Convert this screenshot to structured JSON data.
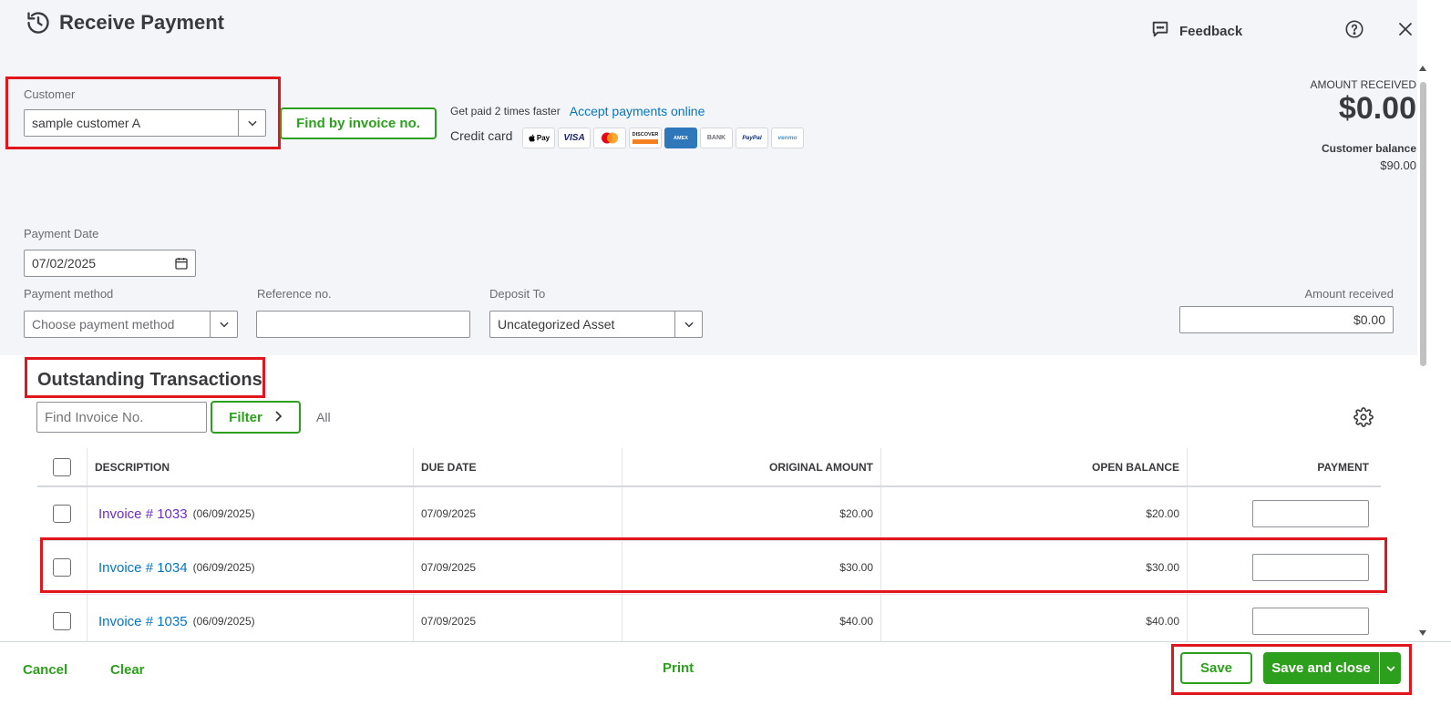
{
  "header": {
    "title": "Receive Payment",
    "feedback_label": "Feedback"
  },
  "customer": {
    "label": "Customer",
    "value": "sample customer A",
    "find_button": "Find by invoice no."
  },
  "online": {
    "promo_text": "Get paid 2 times faster",
    "accept_link": "Accept payments online",
    "credit_card_label": "Credit card",
    "cards": [
      "Pay",
      "VISA",
      "",
      "DISCOVER",
      "AMEX",
      "BANK",
      "PayPal",
      "venmo"
    ]
  },
  "summary": {
    "amount_received_label": "AMOUNT RECEIVED",
    "amount_received_value": "$0.00",
    "customer_balance_label": "Customer balance",
    "customer_balance_value": "$90.00"
  },
  "form": {
    "payment_date_label": "Payment Date",
    "payment_date_value": "07/02/2025",
    "payment_method_label": "Payment method",
    "payment_method_placeholder": "Choose payment method",
    "reference_label": "Reference no.",
    "reference_value": "",
    "deposit_label": "Deposit To",
    "deposit_value": "Uncategorized Asset",
    "amount_received_label": "Amount received",
    "amount_received_value": "$0.00"
  },
  "outstanding": {
    "title": "Outstanding Transactions",
    "find_placeholder": "Find Invoice No.",
    "filter_label": "Filter",
    "all_label": "All",
    "columns": [
      "DESCRIPTION",
      "DUE DATE",
      "ORIGINAL AMOUNT",
      "OPEN BALANCE",
      "PAYMENT"
    ],
    "rows": [
      {
        "invoice": "Invoice # 1033",
        "date": "(06/09/2025)",
        "due": "07/09/2025",
        "original": "$20.00",
        "open": "$20.00"
      },
      {
        "invoice": "Invoice # 1034",
        "date": "(06/09/2025)",
        "due": "07/09/2025",
        "original": "$30.00",
        "open": "$30.00"
      },
      {
        "invoice": "Invoice # 1035",
        "date": "(06/09/2025)",
        "due": "07/09/2025",
        "original": "$40.00",
        "open": "$40.00"
      }
    ]
  },
  "footer": {
    "cancel": "Cancel",
    "clear": "Clear",
    "print": "Print",
    "save": "Save",
    "save_and_close": "Save and close"
  },
  "colors": {
    "accent_green": "#2ca01c",
    "link_blue": "#0077c5",
    "visited_purple": "#6b2dc9",
    "highlight_red": "#e0161c",
    "panel_bg": "#f4f5f8"
  }
}
